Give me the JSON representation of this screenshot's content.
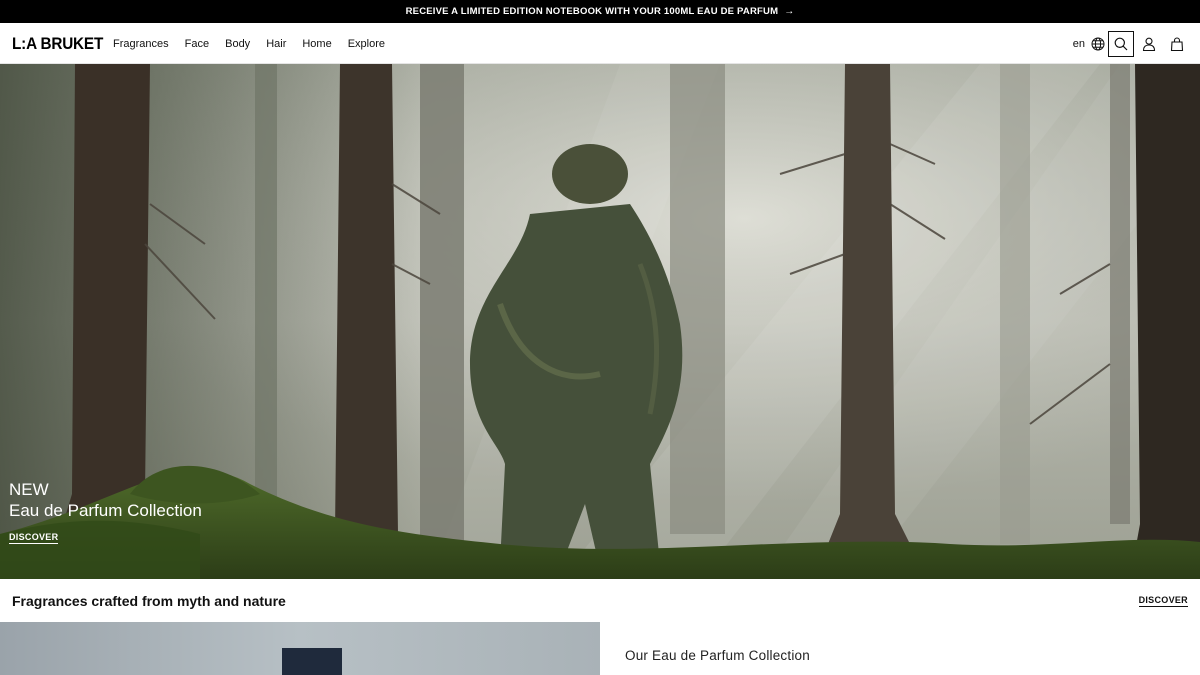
{
  "announcement": {
    "text": "RECEIVE A LIMITED EDITION NOTEBOOK WITH YOUR 100ML EAU DE PARFUM",
    "arrow": "→"
  },
  "header": {
    "logo": "L:A BRUKET",
    "nav": [
      "Fragrances",
      "Face",
      "Body",
      "Hair",
      "Home",
      "Explore"
    ],
    "language": "en",
    "icons": [
      "globe-icon",
      "search-icon",
      "account-icon",
      "bag-icon"
    ]
  },
  "hero": {
    "tag": "NEW",
    "title": "Eau de Parfum Collection",
    "link": "DISCOVER"
  },
  "section": {
    "title": "Fragrances crafted from myth and nature",
    "link": "DISCOVER"
  },
  "feature": {
    "title": "Our Eau de Parfum Collection"
  },
  "colors": {
    "announcement_bg": "#000000",
    "text": "#111111",
    "background": "#ffffff"
  }
}
